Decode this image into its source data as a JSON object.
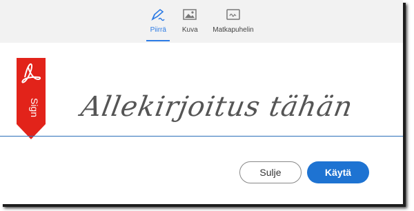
{
  "tabs": [
    {
      "label": "Piirrä",
      "icon": "pen-draw-icon",
      "active": true
    },
    {
      "label": "Kuva",
      "icon": "image-icon",
      "active": false
    },
    {
      "label": "Matkapuhelin",
      "icon": "mobile-signature-icon",
      "active": false
    }
  ],
  "ribbon": {
    "label": "Sign",
    "icon": "acrobat-logo-icon"
  },
  "signature": {
    "text": "Allekirjoitus tähän"
  },
  "buttons": {
    "cancel_label": "Sulje",
    "apply_label": "Käytä"
  },
  "colors": {
    "accent": "#2c7be5",
    "ribbon": "#e2231a",
    "apply": "#1e73d2"
  }
}
